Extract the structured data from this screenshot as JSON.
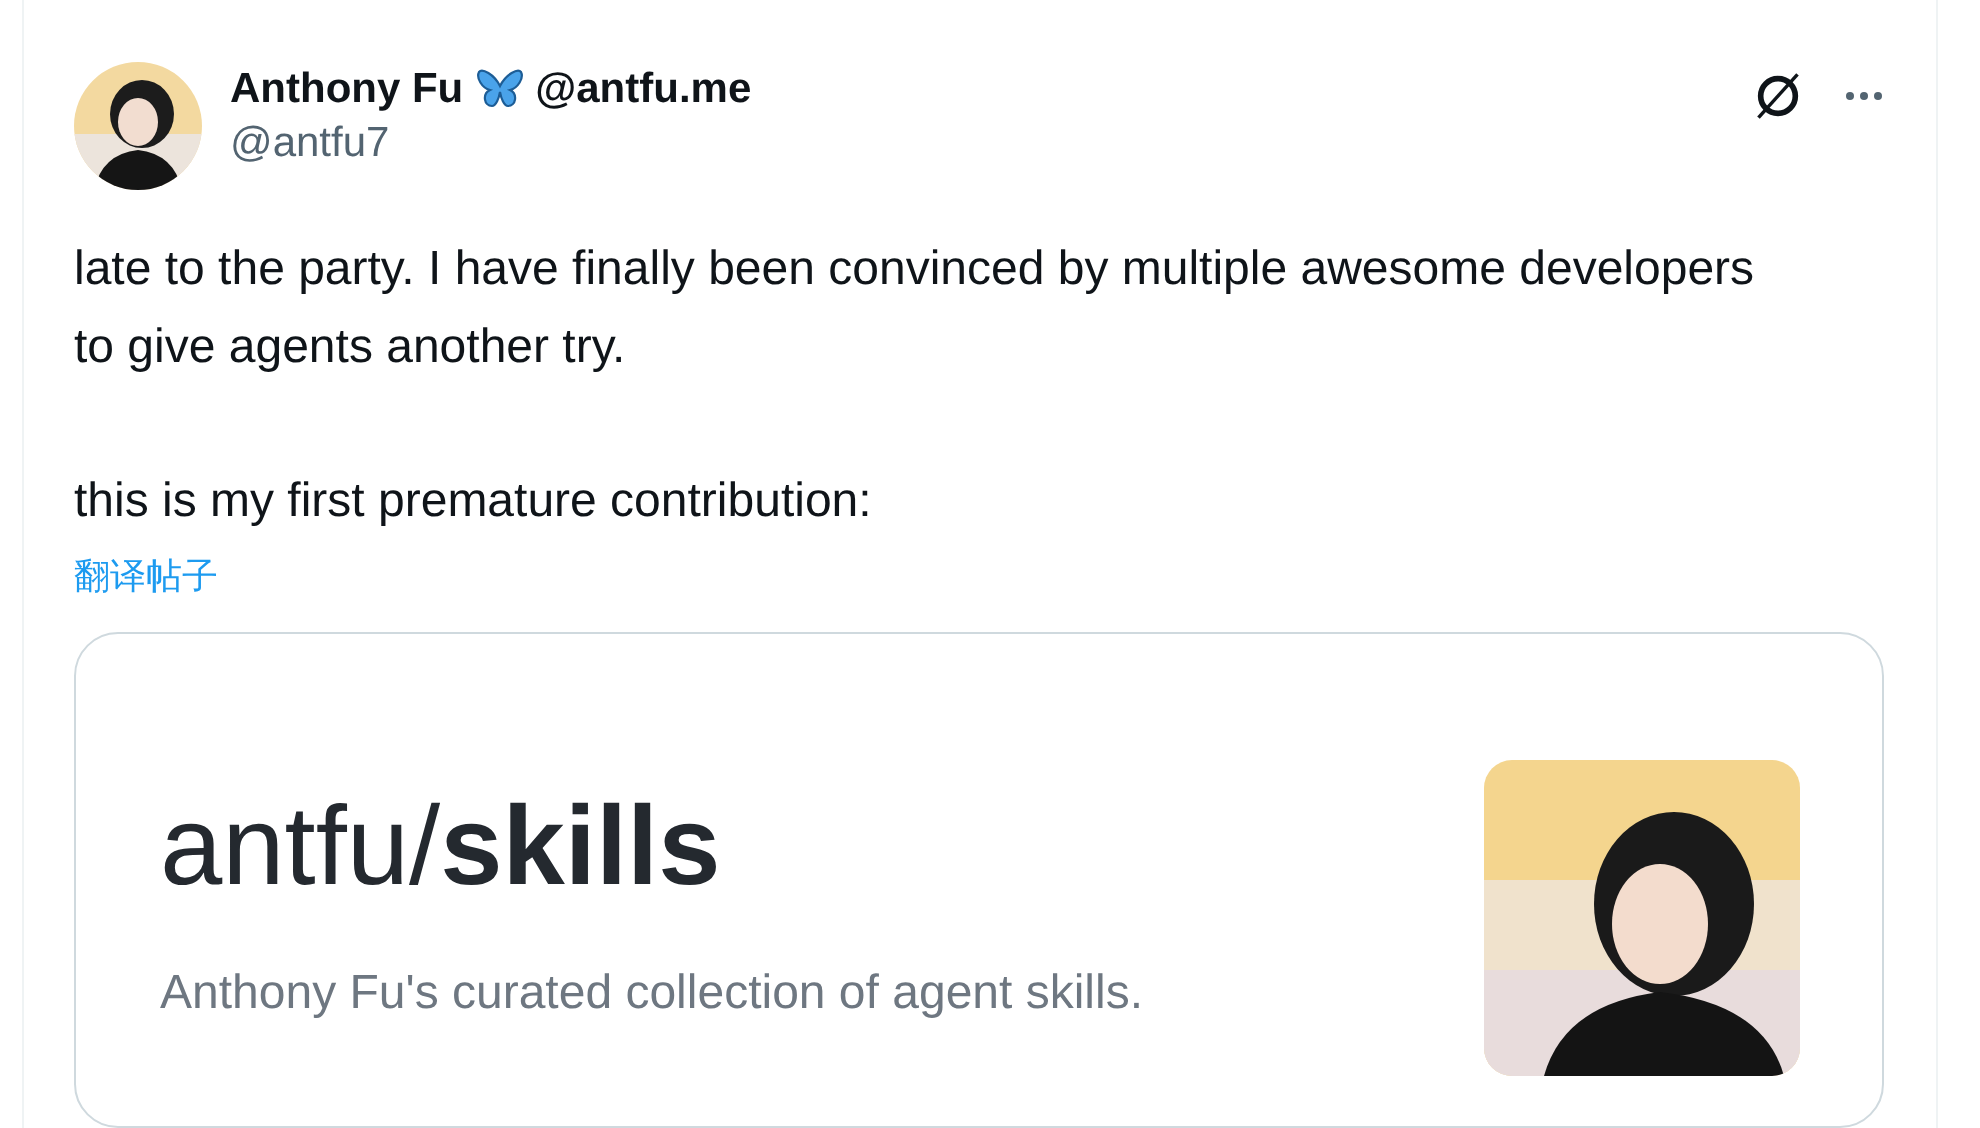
{
  "post": {
    "author": {
      "name": "Anthony Fu",
      "site": "@antfu.me",
      "handle": "@antfu7"
    },
    "paragraphs": [
      "late to the party. I have finally been convinced by multiple awesome developers to give agents another try.",
      "this is my first premature contribution:"
    ],
    "translate_link": "翻译帖子",
    "link_card": {
      "title": "antfu/**skills**",
      "description": "Anthony Fu's curated collection of agent skills."
    }
  }
}
